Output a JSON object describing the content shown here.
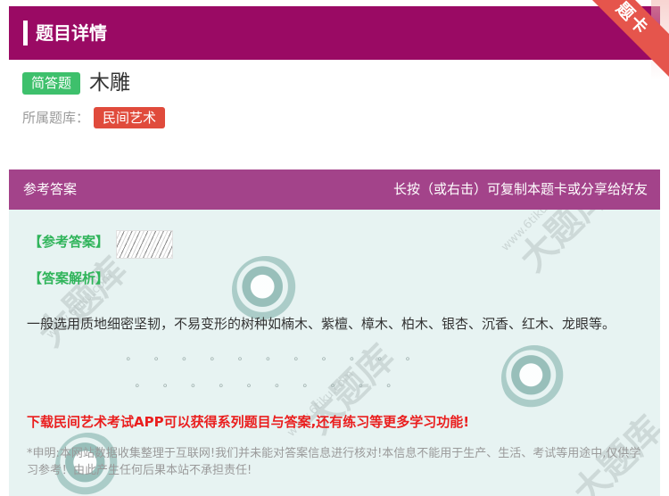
{
  "header": {
    "title": "题目详情"
  },
  "corner_ribbon": {
    "label": "题卡"
  },
  "question": {
    "type_label": "简答题",
    "title": "木雕",
    "bank_label": "所属题库：",
    "bank_tag": "民间艺术"
  },
  "answer_section": {
    "header_left": "参考答案",
    "header_right": "长按（或右击）可复制本题卡或分享给好友",
    "ref_answer_label": "【参考答案】",
    "analysis_label": "【答案解析】",
    "analysis_text": "一般选用质地细密坚韧，不易变形的树种如楠木、紫檀、樟木、柏木、银杏、沉香、红木、龙眼等。",
    "promo_text": "下载民间艺术考试APP可以获得系列题目与答案,还有练习等更多学习功能!",
    "disclaimer": "*申明:本网站数据收集整理于互联网!我们并未能对答案信息进行核对!本信息不能用于生产、生活、考试等用途中,仅供学习参考！由此产生任何后果本站不承担责任!"
  },
  "watermark": {
    "big": "大题库",
    "small": "www.6tiku.com"
  },
  "colors": {
    "header_bg": "#9a0a64",
    "answer_header_bg": "#a3438a",
    "answer_body_bg": "#e7f3f2",
    "type_badge": "#3ec06c",
    "bank_tag": "#e04b3c",
    "label_green": "#2fb45a",
    "promo_red": "#ea1e1e"
  }
}
